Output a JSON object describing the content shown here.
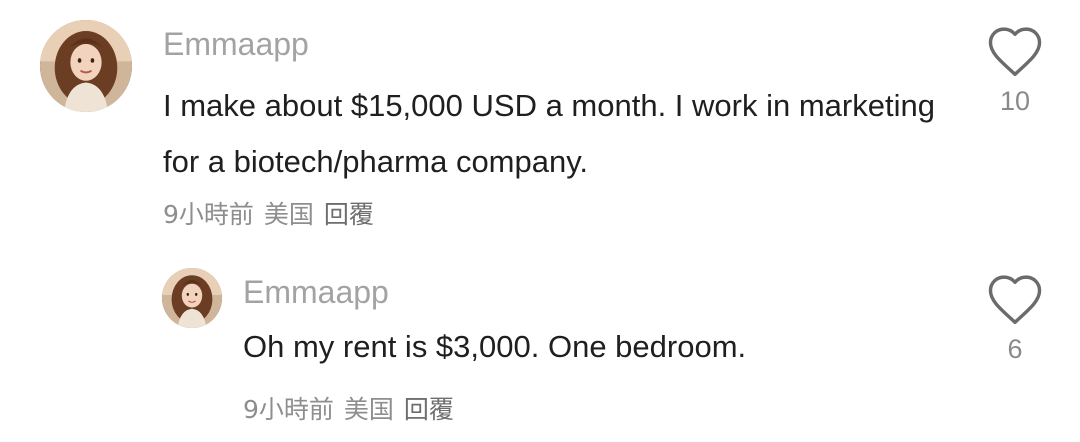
{
  "comments": [
    {
      "username": "Emmaapp",
      "text": "I make about $15,000 USD a month. I work in marketing for a biotech/pharma company.",
      "time": "9小時前",
      "location": "美国",
      "reply_label": "回覆",
      "likes": "10",
      "avatar_icon": "avatar-portrait",
      "like_icon": "heart-outline-icon"
    },
    {
      "username": "Emmaapp",
      "text": "Oh my rent is $3,000. One bedroom.",
      "time": "9小時前",
      "location": "美国",
      "reply_label": "回覆",
      "likes": "6",
      "avatar_icon": "avatar-portrait",
      "like_icon": "heart-outline-icon"
    }
  ],
  "colors": {
    "username": "#a3a3a3",
    "body": "#1f1f1f",
    "meta": "#8e8e8e",
    "count": "#8a8a8a",
    "heart_stroke": "#6b6b6b"
  }
}
